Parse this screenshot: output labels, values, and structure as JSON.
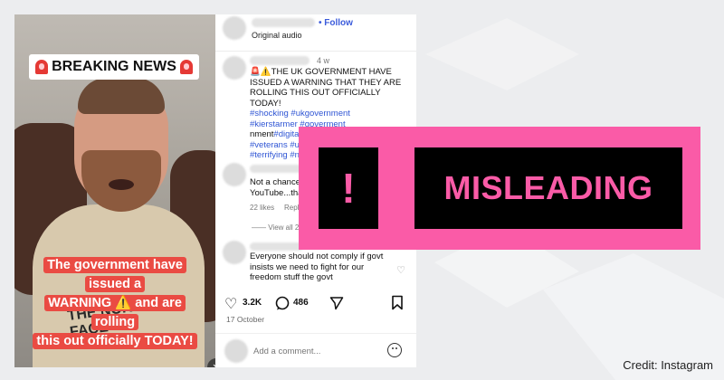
{
  "video": {
    "banner": "BREAKING NEWS",
    "caption_lines": [
      "The government have issued a",
      "WARNING ⚠️ and are rolling",
      "this out officially TODAY!"
    ],
    "shirt_print": "THE NORTH FACE",
    "mute_icon": "speaker-muted-icon"
  },
  "post": {
    "follow_label": "Follow",
    "audio_label": "Original audio",
    "caption_age": "4 w",
    "caption_text": "🚨⚠️THE UK GOVERNMENT HAVE ISSUED A WARNING THAT THEY ARE ROLLING THIS OUT OFFICIALLY TODAY!",
    "caption_tags_1": "#shocking #ukgovernment",
    "caption_tags_2": "#kierstarmer #goverment",
    "caption_tags_3_prefix": "nment",
    "caption_tags_3": "#digitalidentity #id #armyveterans",
    "caption_tags_4": "#veterans #u",
    "caption_tags_5": "#terrifying #n",
    "comment1_text_1": "Not a chance",
    "comment1_text_2": "YouTube...tha",
    "comment1_likes": "22 likes",
    "comment1_reply": "Reply",
    "view_all": "View all 2",
    "comment2_text": "Everyone should not comply if govt insists we need to fight for our freedom stuff the govt",
    "like_count": "3.2K",
    "comment_count": "486",
    "date": "17 October",
    "add_comment_placeholder": "Add a comment..."
  },
  "verdict": {
    "symbol": "!",
    "label": "MISLEADING",
    "color": "#fa5ba7"
  },
  "credit": "Credit: Instagram"
}
